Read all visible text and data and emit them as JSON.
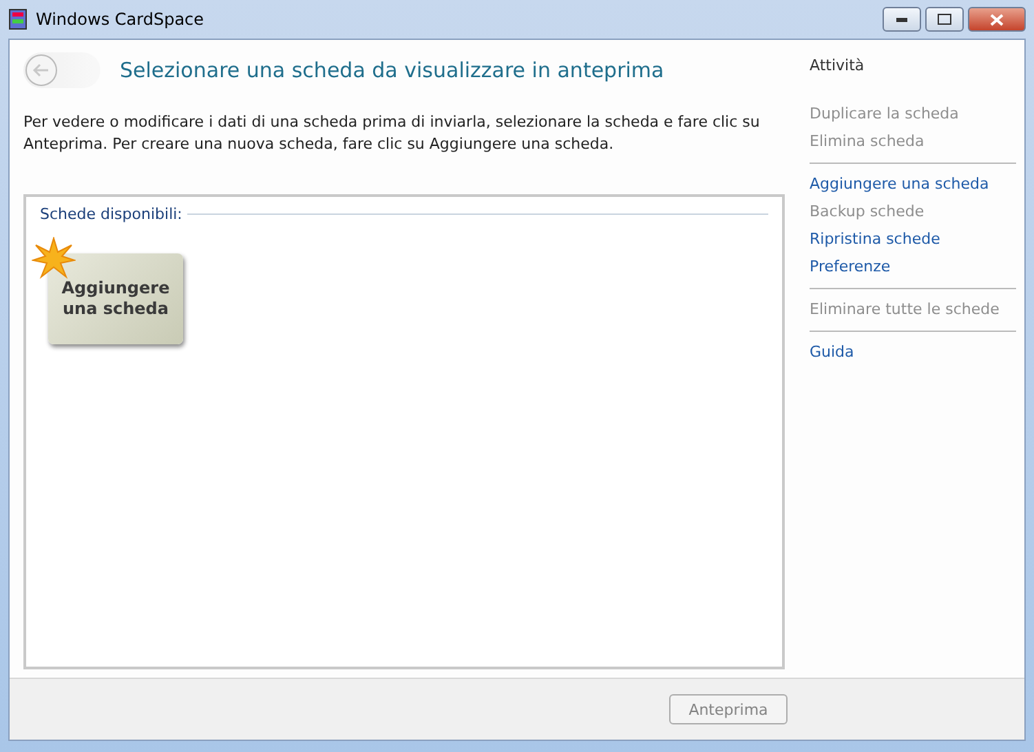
{
  "window": {
    "title": "Windows CardSpace"
  },
  "heading": "Selezionare una scheda da visualizzare in anteprima",
  "back_button": {
    "disabled": true
  },
  "description": "Per vedere o modificare i dati di una scheda prima di inviarla, selezionare la scheda e fare clic su Anteprima. Per creare una nuova scheda, fare clic su Aggiungere una scheda.",
  "cards_panel": {
    "legend": "Schede disponibili:",
    "cards": [
      {
        "label": "Aggiungere una scheda",
        "kind": "add"
      }
    ]
  },
  "tasks": {
    "title": "Attività",
    "groups": [
      {
        "items": [
          {
            "label": "Duplicare la scheda",
            "disabled": true
          },
          {
            "label": "Elimina scheda",
            "disabled": true
          }
        ]
      },
      {
        "items": [
          {
            "label": "Aggiungere una scheda",
            "disabled": false
          },
          {
            "label": "Backup schede",
            "disabled": true
          },
          {
            "label": "Ripristina schede",
            "disabled": false
          },
          {
            "label": "Preferenze",
            "disabled": false
          }
        ]
      },
      {
        "items": [
          {
            "label": "Eliminare tutte le schede",
            "disabled": true
          }
        ]
      },
      {
        "items": [
          {
            "label": "Guida",
            "disabled": false
          }
        ]
      }
    ]
  },
  "footer": {
    "button": {
      "label": "Anteprima",
      "disabled": true
    }
  }
}
